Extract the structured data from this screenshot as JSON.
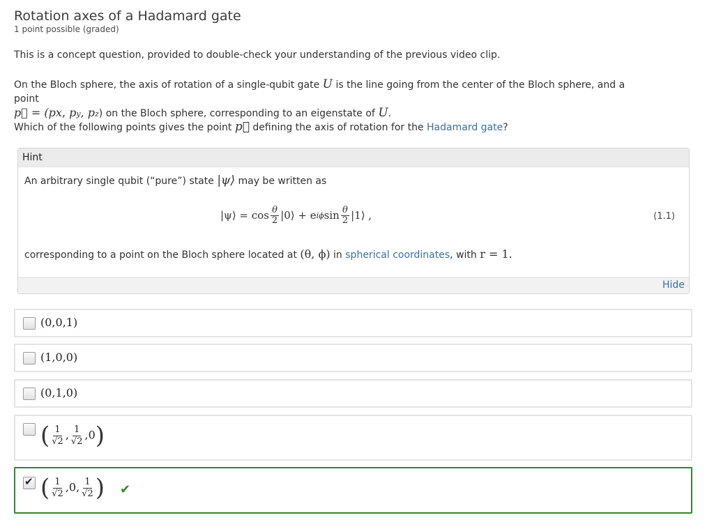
{
  "problem": {
    "title": "Rotation axes of a Hadamard gate",
    "points": "1 point possible (graded)",
    "intro": "This is a concept question, provided to double-check your understanding of the previous video clip.",
    "para_part1": "On the Bloch sphere, the axis of rotation of a single-qubit gate ",
    "para_U": "U",
    "para_part2": " is the line going from the center of the Bloch sphere, and a point",
    "para_vec": "p⃗ = (p",
    "para_vec_tail": ") on the Bloch sphere, corresponding to an eigenstate of ",
    "question_part1": "Which of the following points gives the point ",
    "question_p": "p⃗",
    "question_part2": " defining the axis of rotation for the ",
    "question_link": "Hadamard gate",
    "question_end": "?"
  },
  "hint": {
    "heading": "Hint",
    "text1_part1": "An arbitrary single qubit (“pure”) state ",
    "text1_state": "|ψ⟩",
    "text1_part2": " may be written as",
    "eq_lhs": "|ψ⟩ = cos",
    "eq_theta": "θ",
    "eq_two": "2",
    "eq_mid": "|0⟩ + e",
    "eq_exp": "iϕ",
    "eq_sin": " sin",
    "eq_end": "|1⟩ ,",
    "eq_number": "(1.1)",
    "text2_part1": "corresponding to a point on the Bloch sphere located at ",
    "text2_coords": "(θ, ϕ)",
    "text2_part2": " in ",
    "text2_link": "spherical coordinates",
    "text2_part3": ", with ",
    "text2_r": "r = 1.",
    "hide_label": "Hide"
  },
  "choices": [
    {
      "label": "(0,0,1)",
      "checked": false
    },
    {
      "label": "(1,0,0)",
      "checked": false
    },
    {
      "label": "(0,1,0)",
      "checked": false
    },
    {
      "label": "(1/√2, 1/√2, 0)",
      "checked": false
    },
    {
      "label": "(1/√2, 0, 1/√2)",
      "checked": true
    }
  ],
  "frac": {
    "num": "1",
    "den": "√2",
    "zero": "0"
  },
  "colors": {
    "link": "#3a6ea5",
    "correct": "#2b8a2b"
  }
}
